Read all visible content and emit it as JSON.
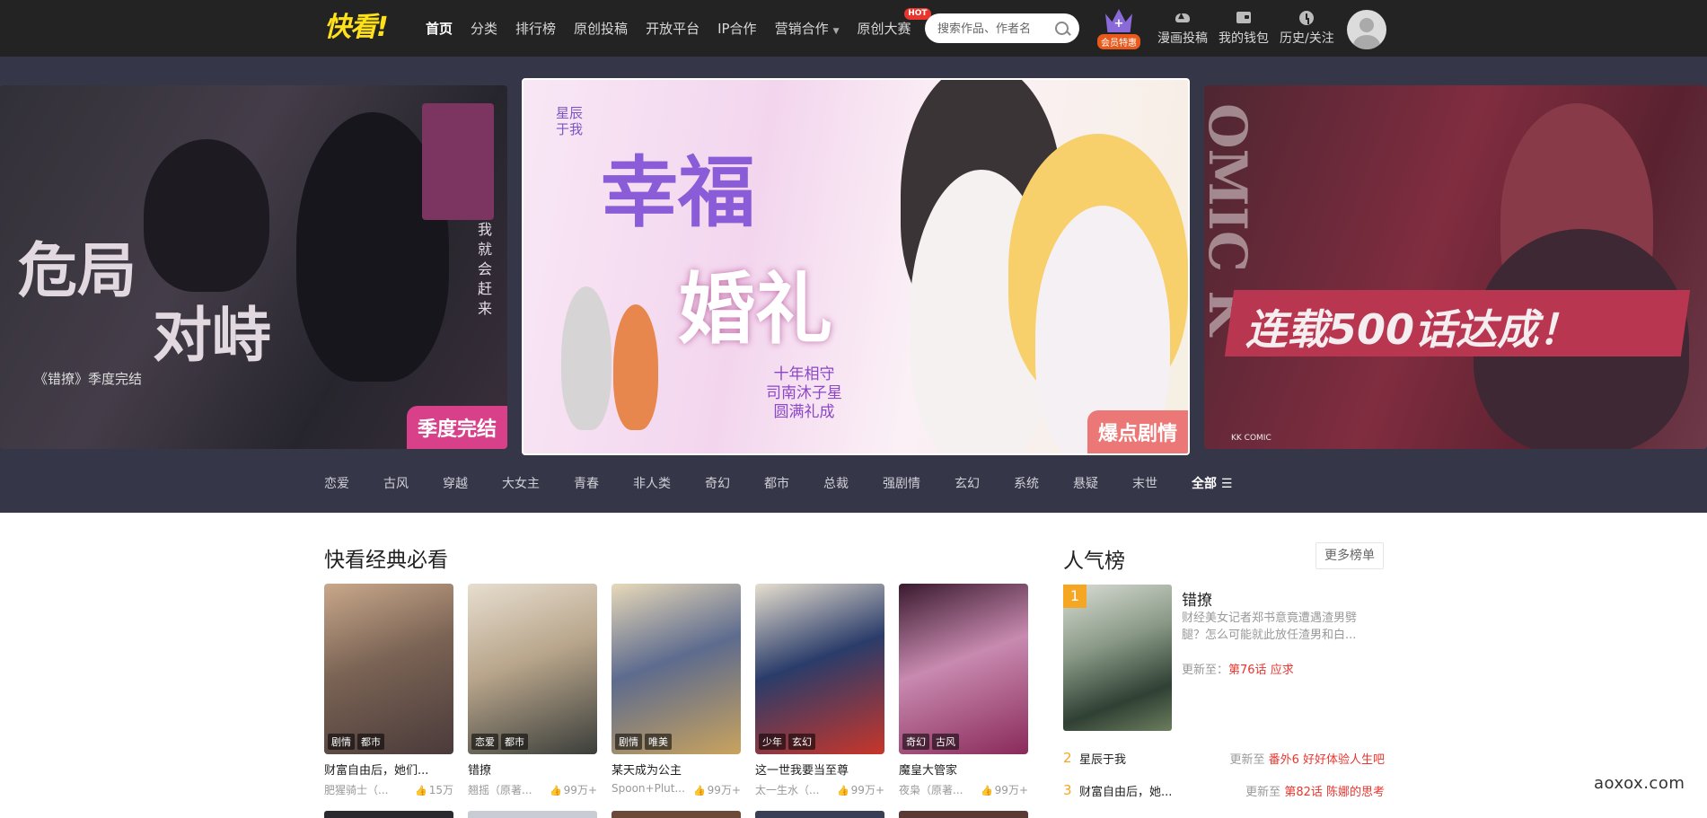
{
  "header": {
    "logo": "快看!",
    "nav": [
      {
        "label": "首页",
        "active": true
      },
      {
        "label": "分类"
      },
      {
        "label": "排行榜"
      },
      {
        "label": "原创投稿"
      },
      {
        "label": "开放平台"
      },
      {
        "label": "IP合作"
      },
      {
        "label": "营销合作"
      },
      {
        "label": "原创大赛"
      }
    ],
    "hot_badge": "HOT",
    "search_placeholder": "搜索作品、作者名",
    "vip_label": "会员特惠",
    "utils": [
      "漫画投稿",
      "我的钱包",
      "历史/关注"
    ]
  },
  "banners": {
    "left": {
      "title_lines": [
        "危局",
        "对峙"
      ],
      "subtitle": "《错撩》季度完结",
      "side_text": "我就会赶来",
      "tag": "季度完结",
      "tag_color": "#d8418a"
    },
    "center": {
      "title_a": "幸福",
      "title_b": "婚礼",
      "caption_lines": [
        "十年相守",
        "司南沐子星",
        "圆满礼成"
      ],
      "brand": "星辰于我",
      "tag": "爆点剧情",
      "tag_color": "#e86a6a"
    },
    "right": {
      "side_text": "OMIC K",
      "headline": "连载500话达成！",
      "tag": "KK COMIC"
    }
  },
  "categories": [
    "恋爱",
    "古风",
    "穿越",
    "大女主",
    "青春",
    "非人类",
    "奇幻",
    "都市",
    "总裁",
    "强剧情",
    "玄幻",
    "系统",
    "悬疑",
    "末世",
    "全部"
  ],
  "classics": {
    "title": "快看经典必看",
    "items": [
      {
        "title": "财富自由后，她们...",
        "author": "肥猩骑士（...",
        "likes": "15万",
        "tags": [
          "剧情",
          "都市"
        ],
        "colors": [
          "#c9a88b",
          "#4a3a3a",
          "#7a6354"
        ]
      },
      {
        "title": "错撩",
        "author": "翘摇（原著...",
        "likes": "99万+",
        "tags": [
          "恋爱",
          "都市"
        ],
        "colors": [
          "#e7ded0",
          "#3b3e3a",
          "#b8a58b"
        ]
      },
      {
        "title": "某天成为公主",
        "author": "Spoon+Plut...",
        "likes": "99万+",
        "tags": [
          "剧情",
          "唯美"
        ],
        "colors": [
          "#e8d9b9",
          "#c9a35d",
          "#5d6b8e"
        ]
      },
      {
        "title": "这一世我要当至尊",
        "author": "太一生水（...",
        "likes": "99万+",
        "tags": [
          "少年",
          "玄幻"
        ],
        "colors": [
          "#e7dfcf",
          "#c8362a",
          "#2a3c6a"
        ]
      },
      {
        "title": "魔皇大管家",
        "author": "夜枭（原著...",
        "likes": "99万+",
        "tags": [
          "奇幻",
          "古风"
        ],
        "colors": [
          "#3a1a2e",
          "#8a2a5a",
          "#c88ab0"
        ]
      }
    ]
  },
  "ranking": {
    "title": "人气榜",
    "more": "更多榜单",
    "top": {
      "rank": "1",
      "title": "错撩",
      "desc": "财经美女记者郑书意竟遭遇渣男劈腿？怎么可能就此放任渣男和白...",
      "update_prefix": "更新至：",
      "update": "第76话 应求"
    },
    "rows": [
      {
        "rank": "2",
        "title": "星辰于我",
        "update_prefix": "更新至",
        "update": "番外6 好好体验人生吧"
      },
      {
        "rank": "3",
        "title": "财富自由后，她...",
        "update_prefix": "更新至",
        "update": "第82话 陈娜的思考"
      }
    ]
  },
  "watermark": "aoxox.com",
  "colors": {
    "topbar": "#232323",
    "banner_bg": "#363649",
    "accent": "#e8362f",
    "rank_gold": "#f5a623"
  }
}
